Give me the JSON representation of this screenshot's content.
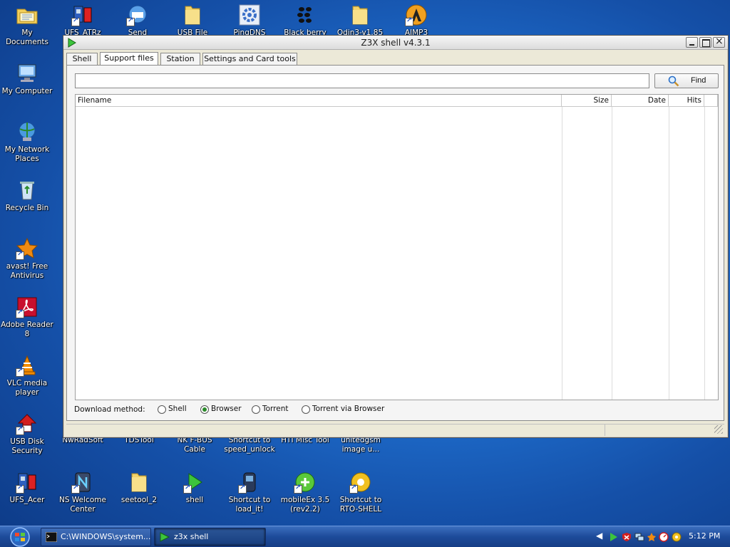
{
  "desktop": {
    "icons": [
      {
        "label": "My Documents",
        "icon": "folder-documents-icon"
      },
      {
        "label": "UFS_ATRz",
        "icon": "ufs-app-icon"
      },
      {
        "label": "Send Feedback",
        "icon": "feedback-icon"
      },
      {
        "label": "USB File",
        "icon": "folder-icon"
      },
      {
        "label": "PingDNS",
        "icon": "gear-icon"
      },
      {
        "label": "Black berry",
        "icon": "blackberry-icon"
      },
      {
        "label": "Odin3-v1.85",
        "icon": "folder-icon"
      },
      {
        "label": "AIMP3",
        "icon": "aimp-icon"
      },
      {
        "label": "My Computer",
        "icon": "computer-icon"
      },
      {
        "label": "My Network Places",
        "icon": "network-icon"
      },
      {
        "label": "Recycle Bin",
        "icon": "recycle-bin-icon"
      },
      {
        "label": "avast! Free Antivirus",
        "icon": "avast-icon"
      },
      {
        "label": "Adobe Reader 8",
        "icon": "adobe-reader-icon"
      },
      {
        "label": "VLC media player",
        "icon": "vlc-icon"
      },
      {
        "label": "USB Disk Security",
        "icon": "usb-security-icon"
      },
      {
        "label": "UFS_Acer",
        "icon": "ufs-app-icon"
      },
      {
        "label": "NS Welcome Center",
        "icon": "ns-icon"
      },
      {
        "label": "seetool_2",
        "icon": "folder-icon"
      },
      {
        "label": "shell",
        "icon": "shell-icon"
      },
      {
        "label": "Shortcut to load_it!",
        "icon": "shortcut-icon"
      },
      {
        "label": "mobileEx 3.5 (rev2.2)",
        "icon": "mobileex-icon"
      },
      {
        "label": "Shortcut to RTO-SHELL",
        "icon": "rto-shell-icon"
      },
      {
        "label": "NwRadSoft",
        "icon": "partial-icon"
      },
      {
        "label": "TDSTool",
        "icon": "partial-icon"
      },
      {
        "label": "NK F-BUS Cable",
        "icon": "partial-icon"
      },
      {
        "label": "Shortcut to speed_unlock",
        "icon": "partial-icon"
      },
      {
        "label": "HTI Misc Tool",
        "icon": "partial-icon"
      },
      {
        "label": "unitedgsm image u...",
        "icon": "partial-icon"
      }
    ]
  },
  "window": {
    "title": "Z3X shell v4.3.1",
    "tabs": [
      {
        "label": "Shell"
      },
      {
        "label": "Support files"
      },
      {
        "label": "Station"
      },
      {
        "label": "Settings and Card tools"
      }
    ],
    "active_tab": "Support files",
    "search": {
      "value": "",
      "placeholder": ""
    },
    "find_label": "Find",
    "columns": [
      "Filename",
      "Size",
      "Date",
      "Hits"
    ],
    "rows": [],
    "download_method_label": "Download method:",
    "download_options": [
      "Shell",
      "Browser",
      "Torrent",
      "Torrent via Browser"
    ],
    "download_selected": "Browser"
  },
  "taskbar": {
    "buttons": [
      {
        "label": "C:\\WINDOWS\\system..."
      },
      {
        "label": "z3x shell"
      }
    ],
    "clock": "5:12 PM"
  }
}
